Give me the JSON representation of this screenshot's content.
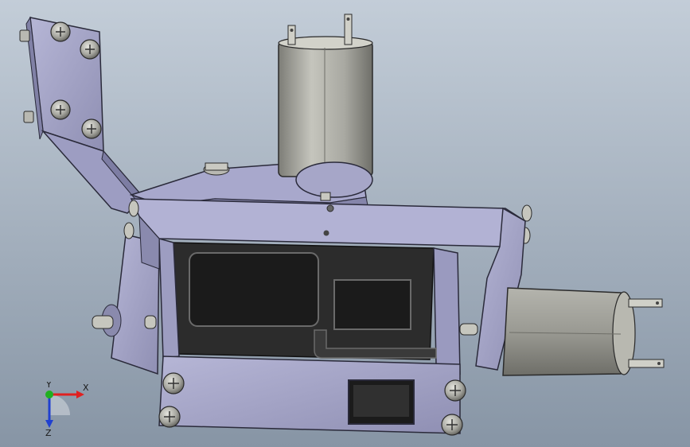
{
  "view": {
    "background_top": "#c3cdd8",
    "background_bottom": "#8795a5",
    "part_color": "#a3a3c6",
    "motor_color": "#a9a9a2"
  },
  "triad": {
    "x_label": "X",
    "y_label": "Y",
    "z_label": "Z",
    "x_color": "#e02020",
    "y_color": "#20b020",
    "z_color": "#2040d0"
  }
}
